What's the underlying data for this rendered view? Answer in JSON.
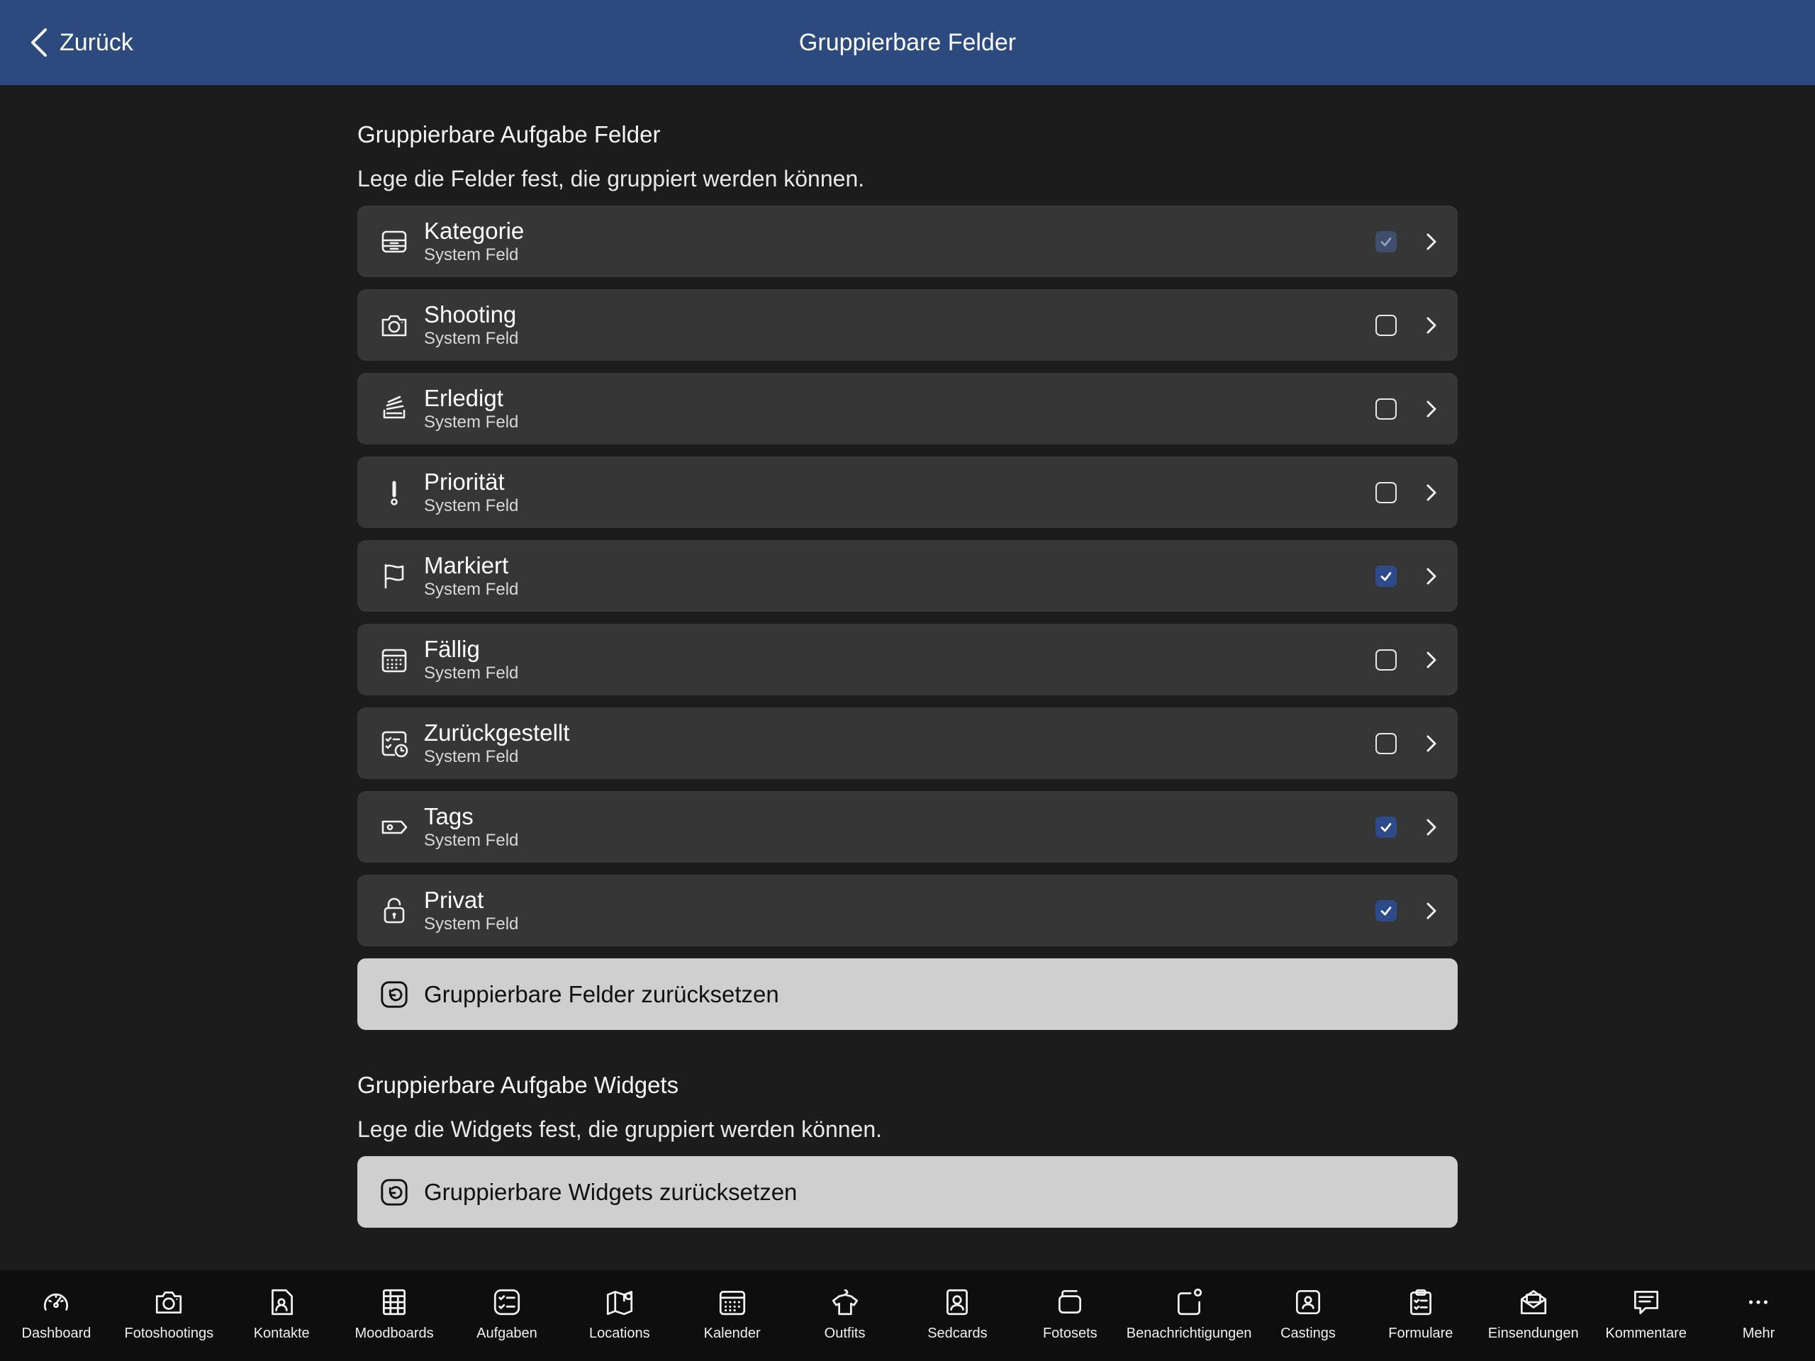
{
  "header": {
    "back_label": "Zurück",
    "title": "Gruppierbare Felder"
  },
  "fields_section": {
    "title": "Gruppierbare Aufgabe Felder",
    "description": "Lege die Felder fest, die gruppiert werden können.",
    "items": [
      {
        "name": "Kategorie",
        "sub": "System Feld",
        "icon": "tray-icon",
        "checked": true,
        "dim": true
      },
      {
        "name": "Shooting",
        "sub": "System Feld",
        "icon": "camera-icon",
        "checked": false
      },
      {
        "name": "Erledigt",
        "sub": "System Feld",
        "icon": "stack-icon",
        "checked": false
      },
      {
        "name": "Priorität",
        "sub": "System Feld",
        "icon": "exclamation-icon",
        "checked": false
      },
      {
        "name": "Markiert",
        "sub": "System Feld",
        "icon": "flag-icon",
        "checked": true
      },
      {
        "name": "Fällig",
        "sub": "System Feld",
        "icon": "calendar-icon",
        "checked": false
      },
      {
        "name": "Zurückgestellt",
        "sub": "System Feld",
        "icon": "checklist-clock-icon",
        "checked": false
      },
      {
        "name": "Tags",
        "sub": "System Feld",
        "icon": "tag-icon",
        "checked": true
      },
      {
        "name": "Privat",
        "sub": "System Feld",
        "icon": "lock-icon",
        "checked": true
      }
    ],
    "reset_label": "Gruppierbare Felder zurücksetzen"
  },
  "widgets_section": {
    "title": "Gruppierbare Aufgabe Widgets",
    "description": "Lege die Widgets fest, die gruppiert werden können.",
    "reset_label": "Gruppierbare Widgets zurücksetzen"
  },
  "tabbar": {
    "items": [
      {
        "label": "Dashboard",
        "icon": "gauge-icon"
      },
      {
        "label": "Fotoshootings",
        "icon": "camera-icon"
      },
      {
        "label": "Kontakte",
        "icon": "contact-icon"
      },
      {
        "label": "Moodboards",
        "icon": "grid-board-icon"
      },
      {
        "label": "Aufgaben",
        "icon": "checklist-icon"
      },
      {
        "label": "Locations",
        "icon": "map-icon"
      },
      {
        "label": "Kalender",
        "icon": "calendar-icon"
      },
      {
        "label": "Outfits",
        "icon": "hanger-shirt-icon"
      },
      {
        "label": "Sedcards",
        "icon": "portrait-card-icon"
      },
      {
        "label": "Fotosets",
        "icon": "photo-stack-icon"
      },
      {
        "label": "Benachrichtigungen",
        "icon": "notification-icon"
      },
      {
        "label": "Castings",
        "icon": "badge-person-icon"
      },
      {
        "label": "Formulare",
        "icon": "clipboard-icon"
      },
      {
        "label": "Einsendungen",
        "icon": "envelope-open-icon"
      },
      {
        "label": "Kommentare",
        "icon": "comment-icon"
      },
      {
        "label": "Mehr",
        "icon": "ellipsis-icon"
      }
    ]
  },
  "colors": {
    "header": "#2d4a7e",
    "background": "#1c1c1c",
    "row": "#363636",
    "check_on": "#2d4a8a",
    "reset_button": "#cfcfcf"
  }
}
